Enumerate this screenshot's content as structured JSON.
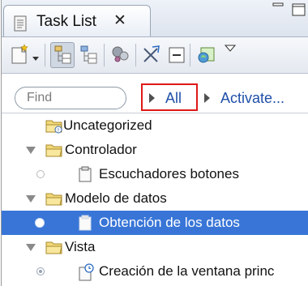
{
  "view": {
    "tab_title": "Task List",
    "tab_close_glyph": "✕"
  },
  "toolbar": {
    "icons": [
      "new-task-icon",
      "dropdown-arrow-icon",
      "categorized-view-icon",
      "scheduled-view-icon",
      "sync-icon",
      "hide-completed-icon",
      "collapse-all-icon",
      "working-set-icon",
      "view-menu-icon"
    ]
  },
  "filter": {
    "find_placeholder": "Find",
    "all_label": "All",
    "activate_label": "Activate...",
    "highlight_color": "#e01818"
  },
  "tree": {
    "rows": [
      {
        "label": "Uncategorized",
        "type": "category",
        "expanded": false
      },
      {
        "label": "Controlador",
        "type": "category",
        "expanded": true
      },
      {
        "label": "Escuchadores botones",
        "type": "task",
        "active": false
      },
      {
        "label": "Modelo de datos",
        "type": "category",
        "expanded": true
      },
      {
        "label": "Obtención de los datos",
        "type": "task",
        "active": true,
        "selected": true
      },
      {
        "label": "Vista",
        "type": "category",
        "expanded": true
      },
      {
        "label": "Creación de la ventana princ",
        "type": "scheduled-task",
        "active": false
      }
    ]
  },
  "colors": {
    "selection": "#3875d7",
    "link": "#1f4fa8"
  }
}
